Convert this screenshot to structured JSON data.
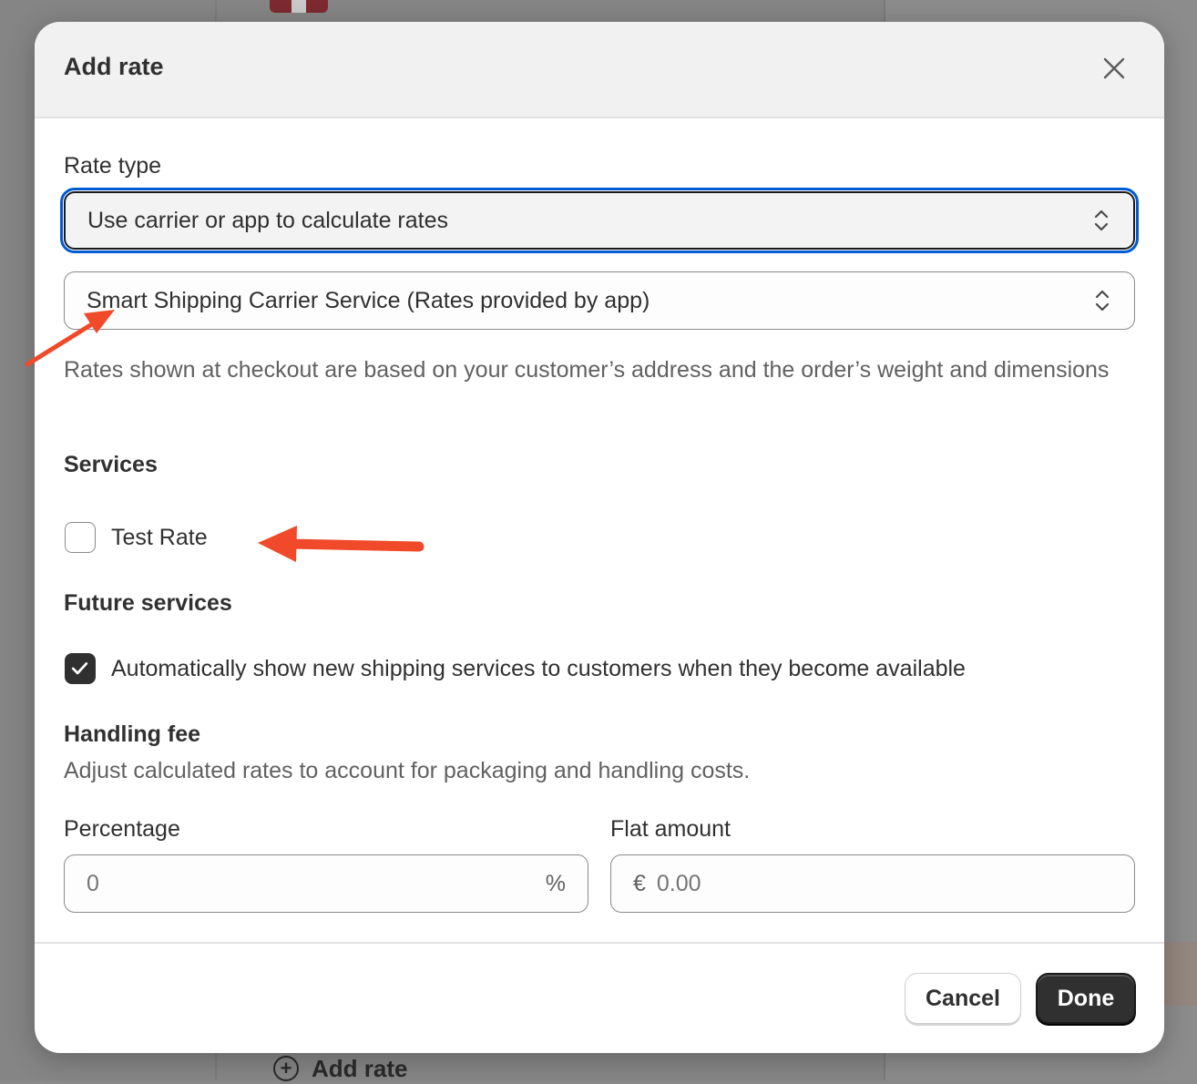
{
  "background": {
    "add_rate_label": "Add rate"
  },
  "modal": {
    "title": "Add rate",
    "close_icon": "close-icon"
  },
  "rate_type": {
    "label": "Rate type",
    "selected": "Use carrier or app to calculate rates"
  },
  "carrier": {
    "selected": "Smart Shipping Carrier Service (Rates provided by app)",
    "help_text": "Rates shown at checkout are based on your customer’s address and the order’s weight and dimensions"
  },
  "services": {
    "heading": "Services",
    "items": [
      {
        "label": "Test Rate",
        "checked": false
      }
    ]
  },
  "future_services": {
    "heading": "Future services",
    "option_label": "Automatically show new shipping services to customers when they become available",
    "checked": true
  },
  "handling_fee": {
    "heading": "Handling fee",
    "description": "Adjust calculated rates to account for packaging and handling costs.",
    "percentage": {
      "label": "Percentage",
      "placeholder": "0",
      "suffix": "%"
    },
    "flat_amount": {
      "label": "Flat amount",
      "prefix": "€",
      "placeholder": "0.00"
    }
  },
  "footer": {
    "cancel_label": "Cancel",
    "done_label": "Done"
  },
  "colors": {
    "annotation_arrow": "#f04a2a",
    "focus_ring": "#005bd3",
    "primary_button": "#303030"
  }
}
